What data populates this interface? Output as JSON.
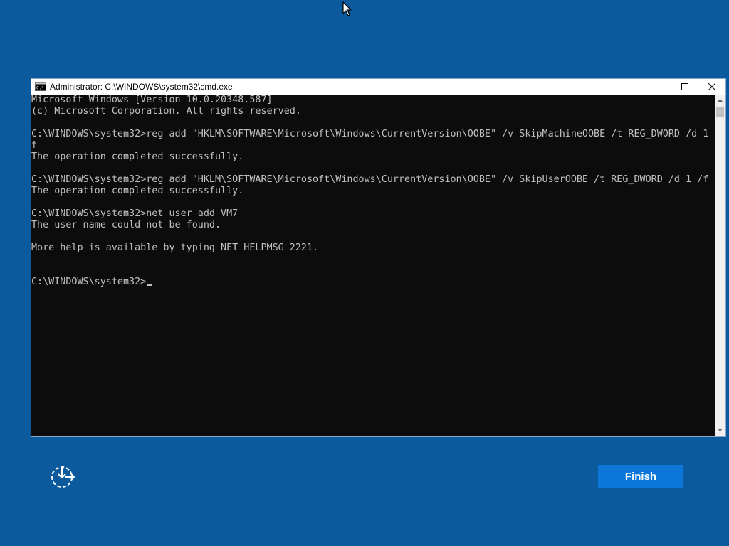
{
  "window": {
    "title": "Administrator: C:\\WINDOWS\\system32\\cmd.exe",
    "icon": "cmd-icon",
    "controls": [
      "minimize-icon",
      "maximize-icon",
      "close-icon"
    ]
  },
  "console": {
    "lines": [
      "Microsoft Windows [Version 10.0.20348.587]",
      "(c) Microsoft Corporation. All rights reserved.",
      "",
      "C:\\WINDOWS\\system32>reg add \"HKLM\\SOFTWARE\\Microsoft\\Windows\\CurrentVersion\\OOBE\" /v SkipMachineOOBE /t REG_DWORD /d 1 /",
      "f",
      "The operation completed successfully.",
      "",
      "C:\\WINDOWS\\system32>reg add \"HKLM\\SOFTWARE\\Microsoft\\Windows\\CurrentVersion\\OOBE\" /v SkipUserOOBE /t REG_DWORD /d 1 /f",
      "The operation completed successfully.",
      "",
      "C:\\WINDOWS\\system32>net user add VM7",
      "The user name could not be found.",
      "",
      "More help is available by typing NET HELPMSG 2221.",
      "",
      ""
    ],
    "prompt": "C:\\WINDOWS\\system32>",
    "text_color": "#c0c0c0",
    "background": "#0c0c0c"
  },
  "oobe": {
    "finish_label": "Finish",
    "accessibility_icon": "ease-of-access-icon",
    "background": "#0a5a9d",
    "accent": "#0c77d8"
  }
}
